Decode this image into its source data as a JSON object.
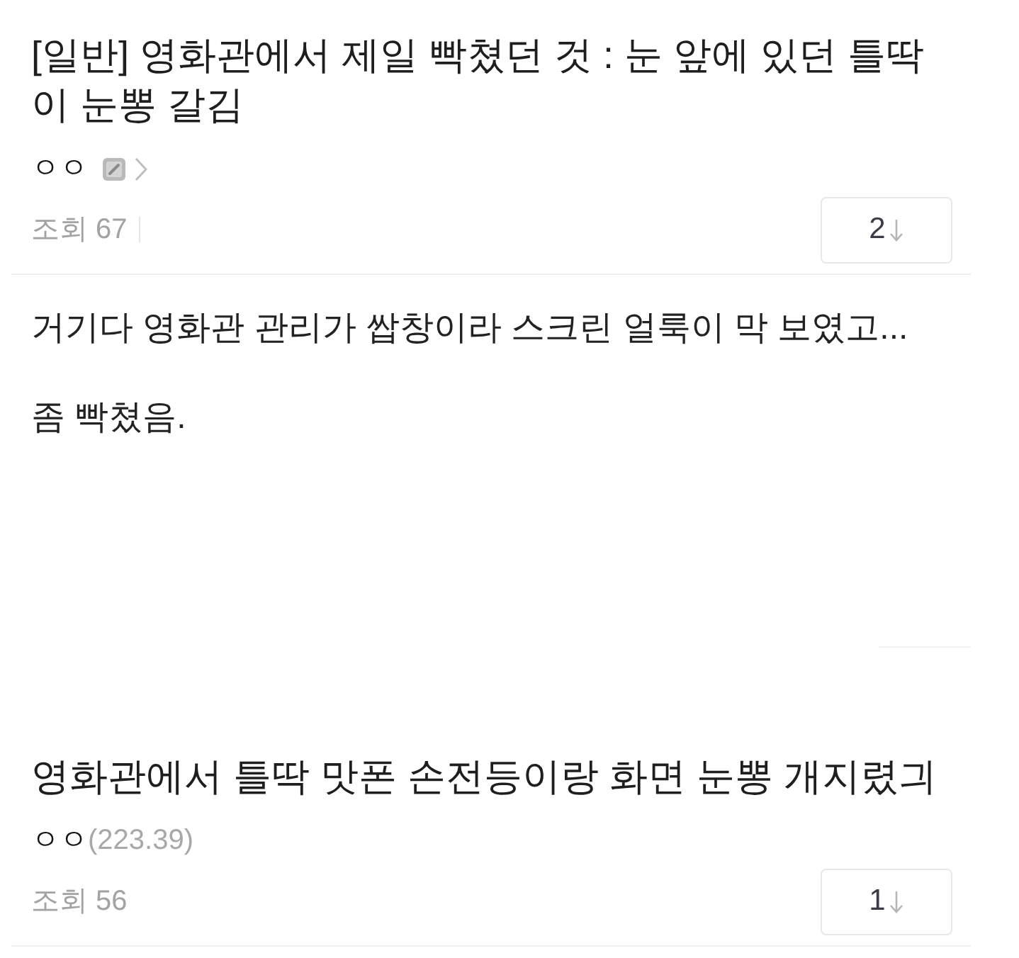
{
  "posts": [
    {
      "title": "[일반] 영화관에서 제일 빡쳤던 것 : 눈 앞에 있던 틀딱이 눈뽕 갈김",
      "author": "ㅇㅇ",
      "author_badge": true,
      "author_link": true,
      "views": "조회 67",
      "comment_count": "2",
      "body": [
        "거기다 영화관 관리가 쌉창이라 스크린 얼룩이 막 보였고...",
        "좀 빡쳤음."
      ]
    },
    {
      "title": "영화관에서 틀딱 맛폰 손전등이랑 화면 눈뽕 개지렸긔",
      "author": "ㅇㅇ",
      "author_ip": "(223.39)",
      "views": "조회 56",
      "comment_count": "1"
    }
  ]
}
